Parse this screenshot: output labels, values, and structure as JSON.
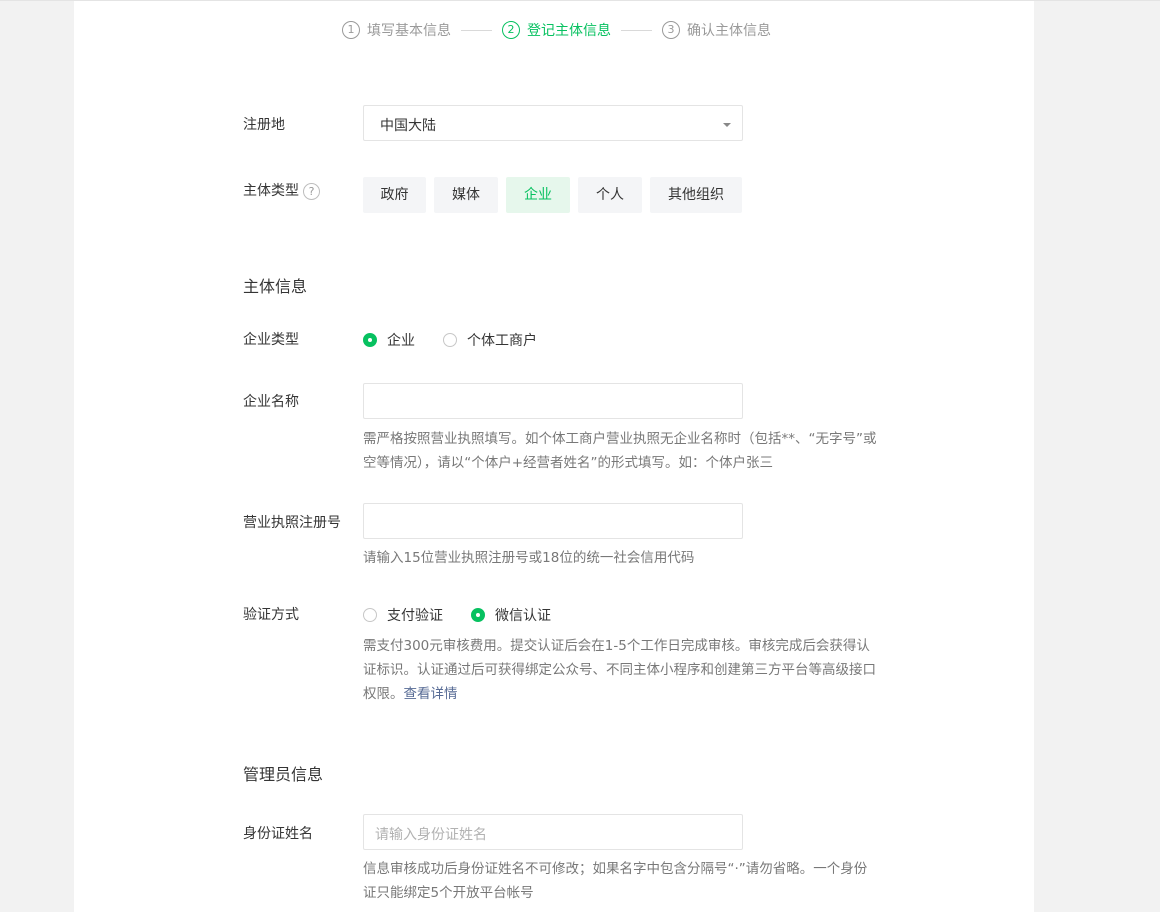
{
  "steps": [
    {
      "num": "1",
      "label": "填写基本信息"
    },
    {
      "num": "2",
      "label": "登记主体信息"
    },
    {
      "num": "3",
      "label": "确认主体信息"
    }
  ],
  "region": {
    "label": "注册地",
    "value": "中国大陆"
  },
  "entity_type": {
    "label": "主体类型",
    "help": "?",
    "options": [
      "政府",
      "媒体",
      "企业",
      "个人",
      "其他组织"
    ],
    "selected": "企业"
  },
  "entity_info": {
    "section_title": "主体信息",
    "company_type": {
      "label": "企业类型",
      "options": [
        "企业",
        "个体工商户"
      ],
      "selected": "企业"
    },
    "company_name": {
      "label": "企业名称",
      "value": "",
      "hint_line1": "需严格按照营业执照填写。如个体工商户营业执照无企业名称时（包括**、“无字号”或",
      "hint_line2": "空等情况），请以“个体户+经营者姓名”的形式填写。如：个体户张三"
    },
    "license_no": {
      "label": "营业执照注册号",
      "value": "",
      "hint": "请输入15位营业执照注册号或18位的统一社会信用代码"
    },
    "verify_method": {
      "label": "验证方式",
      "options": [
        "支付验证",
        "微信认证"
      ],
      "selected": "微信认证",
      "hint_line1": "需支付300元审核费用。提交认证后会在1-5个工作日完成审核。审核完成后会获得认",
      "hint_line2": "证标识。认证通过后可获得绑定公众号、不同主体小程序和创建第三方平台等高级接口",
      "hint_line3": "权限。",
      "details_link": "查看详情"
    }
  },
  "admin_info": {
    "section_title": "管理员信息",
    "id_name": {
      "label": "身份证姓名",
      "placeholder": "请输入身份证姓名",
      "hint_line1": "信息审核成功后身份证姓名不可修改；如果名字中包含分隔号“·”请勿省略。一个身份",
      "hint_line2": "证只能绑定5个开放平台帐号"
    }
  },
  "colors": {
    "accent": "#07c160",
    "link": "#576b95"
  }
}
